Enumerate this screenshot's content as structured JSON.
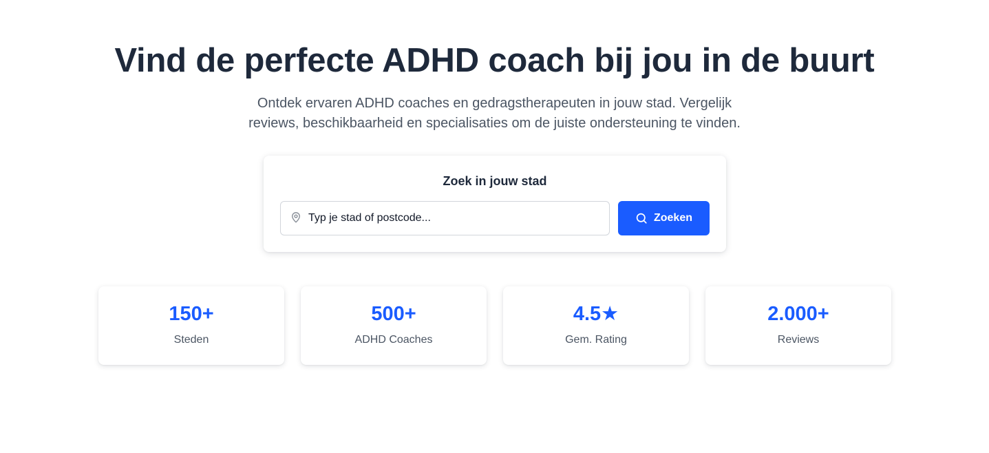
{
  "hero": {
    "title": "Vind de perfecte ADHD coach bij jou in de buurt",
    "subtitle": "Ontdek ervaren ADHD coaches en gedragstherapeuten in jouw stad. Vergelijk reviews, beschikbaarheid en specialisaties om de juiste ondersteuning te vinden."
  },
  "search": {
    "title": "Zoek in jouw stad",
    "placeholder": "Typ je stad of postcode...",
    "value": "",
    "button_label": "Zoeken",
    "input_icon": "map-pin-icon",
    "button_icon": "search-icon"
  },
  "stats": [
    {
      "value": "150+",
      "label": "Steden"
    },
    {
      "value": "500+",
      "label": "ADHD Coaches"
    },
    {
      "value": "4.5★",
      "label": "Gem. Rating"
    },
    {
      "value": "2.000+",
      "label": "Reviews"
    }
  ],
  "colors": {
    "accent": "#1a5cff",
    "heading": "#1e293b",
    "body_text": "#4b5563",
    "background": "#ffffff"
  }
}
